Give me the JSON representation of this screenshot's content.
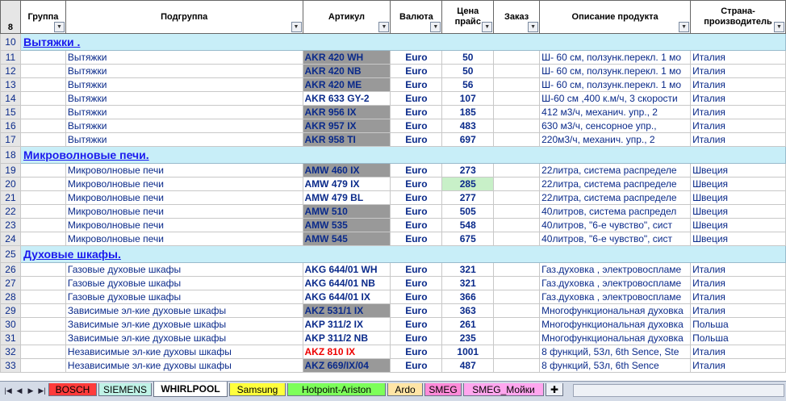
{
  "headers": {
    "row_num": "8",
    "group": "Группа",
    "subgroup": "Подгруппа",
    "article": "Артикул",
    "currency": "Валюта",
    "price": "Цена прайс",
    "order": "Заказ",
    "description": "Описание продукта",
    "country": "Страна-производитель"
  },
  "rows": [
    {
      "type": "section",
      "n": "10",
      "title": "Вытяжки ."
    },
    {
      "n": "11",
      "sub": "Вытяжки",
      "code": "AKR 420 WH",
      "cur": "Euro",
      "price": "50",
      "desc": "Ш- 60 см, ползунк.перекл. 1 мо",
      "country": "Италия",
      "grey": true
    },
    {
      "n": "12",
      "sub": "Вытяжки",
      "code": "AKR 420 NB",
      "cur": "Euro",
      "price": "50",
      "desc": "Ш- 60 см, ползунк.перекл. 1 мо",
      "country": "Италия",
      "grey": true
    },
    {
      "n": "13",
      "sub": "Вытяжки",
      "code": "AKR 420 ME",
      "cur": "Euro",
      "price": "56",
      "desc": "Ш- 60 см, ползунк.перекл. 1 мо",
      "country": "Италия",
      "grey": true
    },
    {
      "n": "14",
      "sub": "Вытяжки",
      "code": "AKR 633 GY-2",
      "cur": "Euro",
      "price": "107",
      "desc": "Ш-60 см ,400 к.м/ч, 3 скорости",
      "country": "Италия"
    },
    {
      "n": "15",
      "sub": "Вытяжки",
      "code": "AKR 956 IX",
      "cur": "Euro",
      "price": "185",
      "desc": " 412 м3/ч, механич. упр., 2",
      "country": "Италия",
      "grey": true
    },
    {
      "n": "16",
      "sub": "Вытяжки",
      "code": "AKR 957 IX",
      "cur": "Euro",
      "price": "483",
      "desc": " 630 м3/ч, сенсорное упр.,",
      "country": "Италия",
      "grey": true
    },
    {
      "n": "17",
      "sub": "Вытяжки",
      "code": "AKR 958 TI",
      "cur": "Euro",
      "price": "697",
      "desc": " 220м3/ч, механич. упр., 2",
      "country": "Италия",
      "grey": true
    },
    {
      "type": "section",
      "n": "18",
      "title": "Микроволновые печи."
    },
    {
      "n": "19",
      "sub": "Микроволновые печи",
      "code": "AMW 460 IX",
      "cur": "Euro",
      "price": "273",
      "desc": " 22литра, система распределе",
      "country": "Швеция",
      "grey": true
    },
    {
      "n": "20",
      "sub": "Микроволновые печи",
      "code": "AMW 479 IX",
      "cur": "Euro",
      "price": "285",
      "desc": " 22литра, система распределе",
      "country": "Швеция",
      "hl": true
    },
    {
      "n": "21",
      "sub": "Микроволновые печи",
      "code": "AMW 479 BL",
      "cur": "Euro",
      "price": "277",
      "desc": " 22литра, система распределе",
      "country": "Швеция"
    },
    {
      "n": "22",
      "sub": "Микроволновые печи",
      "code": "AMW 510",
      "cur": "Euro",
      "price": "505",
      "desc": " 40литров, система распредел",
      "country": "Швеция",
      "grey": true
    },
    {
      "n": "23",
      "sub": "Микроволновые печи",
      "code": "AMW 535",
      "cur": "Euro",
      "price": "548",
      "desc": " 40литров,  \"6-е чувство\", сист",
      "country": "Швеция",
      "grey": true
    },
    {
      "n": "24",
      "sub": "Микроволновые печи",
      "code": "AMW 545",
      "cur": "Euro",
      "price": "675",
      "desc": " 40литров,  \"6-е чувство\", сист",
      "country": "Швеция",
      "grey": true
    },
    {
      "type": "section",
      "n": "25",
      "title": "Духовые шкафы."
    },
    {
      "n": "26",
      "sub": "Газовые духовые шкафы",
      "code": "AKG 644/01 WH",
      "cur": "Euro",
      "price": "321",
      "desc": " Газ.духовка , электровоспламе",
      "country": "Италия"
    },
    {
      "n": "27",
      "sub": "Газовые духовые шкафы",
      "code": "AKG 644/01 NB",
      "cur": "Euro",
      "price": "321",
      "desc": " Газ.духовка , электровоспламе",
      "country": "Италия"
    },
    {
      "n": "28",
      "sub": "Газовые духовые шкафы",
      "code": "AKG 644/01 IX",
      "cur": "Euro",
      "price": "366",
      "desc": " Газ.духовка , электровоспламе",
      "country": "Италия"
    },
    {
      "n": "29",
      "sub": "Зависимые эл-кие духовые шкафы",
      "code": "AKZ 531/1 IX",
      "cur": "Euro",
      "price": "363",
      "desc": "Многофункциональная духовка",
      "country": "Италия",
      "grey": true
    },
    {
      "n": "30",
      "sub": "Зависимые эл-кие духовые шкафы",
      "code": "AKP 311/2 IX",
      "cur": "Euro",
      "price": "261",
      "desc": "Многофункциональная духовка",
      "country": "Польша"
    },
    {
      "n": "31",
      "sub": "Зависимые эл-кие духовые шкафы",
      "code": "AKP 311/2 NB",
      "cur": "Euro",
      "price": "235",
      "desc": "Многофункциональная духовка",
      "country": "Польша"
    },
    {
      "n": "32",
      "sub": "Независимые эл-кие духовы шкафы",
      "code": "AKZ 810 IX",
      "cur": "Euro",
      "price": "1001",
      "desc": " 8 функций, 53л, 6th Sence, Ste",
      "country": "Италия",
      "red": true
    },
    {
      "n": "33",
      "sub": "Независимые эл-кие духовы шкафы",
      "code": "AKZ 669/IX/04",
      "cur": "Euro",
      "price": "487",
      "desc": " 8 функций, 53л, 6th Sence",
      "country": "Италия",
      "grey": true
    }
  ],
  "tabs": [
    "BOSCH",
    "SIEMENS",
    "WHIRLPOOL",
    "Samsung",
    "Hotpoint-Ariston",
    "Ardo",
    "SMEG",
    "SMEG_Мойки"
  ],
  "tab_colors": [
    "#ff3b3b",
    "#bff2e6",
    "#ffffff",
    "#ffff3c",
    "#7dff5a",
    "#ffe5a6",
    "#ff8ad8",
    "#ffa6ee"
  ],
  "active_tab": "WHIRLPOOL"
}
